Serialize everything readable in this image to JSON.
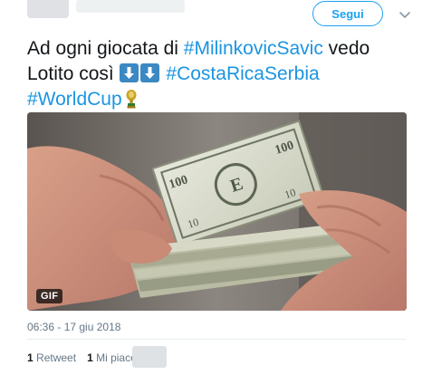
{
  "header": {
    "follow_label": "Segui"
  },
  "tweet": {
    "text_1": "Ad ogni giocata di ",
    "hashtag_milinkovic": "#MilinkovicSavic",
    "text_2": " vedo",
    "text_3": "Lotito così ",
    "hashtag_costarica": "#CostaRicaSerbia",
    "hashtag_worldcup": "#WorldCup"
  },
  "media": {
    "badge": "GIF"
  },
  "meta": {
    "timestamp": "06:36 - 17 giu 2018"
  },
  "stats": {
    "retweet_count": "1",
    "retweet_label": "Retweet",
    "like_count": "1",
    "like_label": "Mi piace"
  },
  "colors": {
    "accent": "#1da1f2",
    "hashtag": "#1b95e0",
    "text": "#14171a",
    "muted": "#657786",
    "emoji_blue": "#3b88c3"
  },
  "icons": [
    "chevron-down-icon",
    "down-arrow-emoji-icon",
    "trophy-emoji-icon"
  ]
}
